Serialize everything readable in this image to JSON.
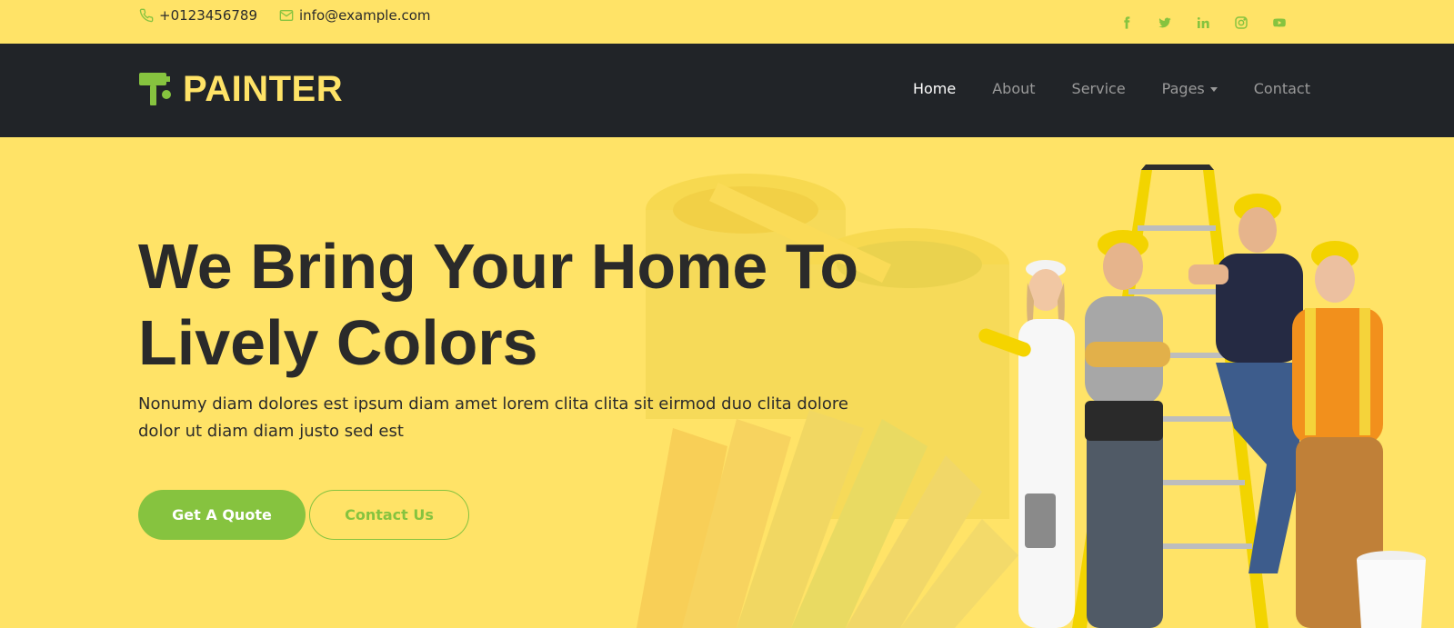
{
  "topbar": {
    "phone": "+0123456789",
    "email": "info@example.com",
    "socials": [
      "facebook-icon",
      "twitter-icon",
      "linkedin-icon",
      "instagram-icon",
      "youtube-icon"
    ]
  },
  "navbar": {
    "brand": "PAINTER",
    "links": [
      {
        "label": "Home",
        "active": true
      },
      {
        "label": "About"
      },
      {
        "label": "Service"
      },
      {
        "label": "Pages",
        "dropdown": true
      },
      {
        "label": "Contact"
      }
    ]
  },
  "hero": {
    "title_line1": "We Bring Your Home To",
    "title_line2": "Lively Colors",
    "text_line1": "Nonumy diam dolores est ipsum diam amet lorem clita clita sit eirmod duo clita dolore",
    "text_line2": "dolor ut diam diam justo sed est",
    "primary_button": "Get A Quote",
    "secondary_button": "Contact Us"
  },
  "colors": {
    "accent": "#86c33f",
    "yellow": "#ffe367",
    "dark": "#212428"
  }
}
